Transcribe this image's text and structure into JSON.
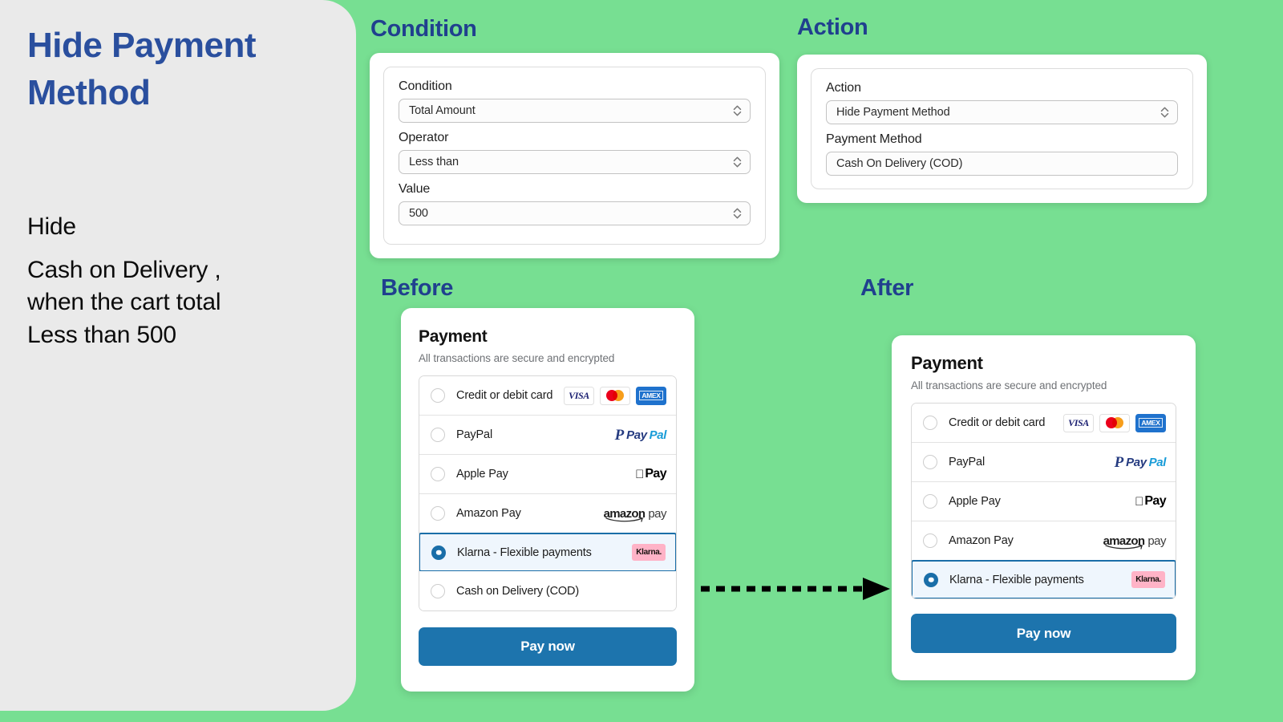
{
  "colors": {
    "background_green": "#77df92",
    "panel_gray": "#eaeaea",
    "heading_blue": "#20408e",
    "title_blue": "#2a4f9e",
    "button_blue": "#1d74ad",
    "selected_row_bg": "#eff6fd",
    "selected_row_border": "#1a6ea8",
    "klarna_pink": "#ffb3c7"
  },
  "left_panel": {
    "title": "Hide Payment Method",
    "description_lines": [
      "Hide",
      "Cash on Delivery ,",
      "when the cart total",
      "Less than 500"
    ]
  },
  "headings": {
    "condition": "Condition",
    "action": "Action",
    "before": "Before",
    "after": "After"
  },
  "condition_form": {
    "fields": [
      {
        "label": "Condition",
        "value": "Total Amount",
        "control": "select",
        "icon": "stepper-chevrons-icon"
      },
      {
        "label": "Operator",
        "value": "Less than",
        "control": "select",
        "icon": "stepper-chevrons-icon"
      },
      {
        "label": "Value",
        "value": "500",
        "control": "number",
        "icon": "stepper-chevrons-icon"
      }
    ]
  },
  "action_form": {
    "fields": [
      {
        "label": "Action",
        "value": "Hide Payment Method",
        "control": "select",
        "icon": "stepper-chevrons-icon"
      },
      {
        "label": "Payment Method",
        "value": "Cash On Delivery (COD)",
        "control": "text",
        "icon": ""
      }
    ]
  },
  "before_checkout": {
    "title": "Payment",
    "subtitle": "All transactions are secure and encrypted",
    "pay_button": "Pay now",
    "methods": [
      {
        "label": "Credit or debit card",
        "selected": false,
        "logo": "cards",
        "logo_labels": [
          "VISA",
          "mastercard-icon",
          "AMEX"
        ]
      },
      {
        "label": "PayPal",
        "selected": false,
        "logo": "paypal",
        "logo_labels": [
          "P",
          "Pay",
          "Pal"
        ]
      },
      {
        "label": "Apple Pay",
        "selected": false,
        "logo": "applepay",
        "logo_labels": [
          "apple-icon",
          "Pay"
        ]
      },
      {
        "label": "Amazon Pay",
        "selected": false,
        "logo": "amazonpay",
        "logo_labels": [
          "amazon",
          "pay"
        ]
      },
      {
        "label": "Klarna - Flexible payments",
        "selected": true,
        "logo": "klarna",
        "logo_labels": [
          "Klarna."
        ]
      },
      {
        "label": "Cash on Delivery (COD)",
        "selected": false,
        "logo": "none",
        "logo_labels": []
      }
    ]
  },
  "after_checkout": {
    "title": "Payment",
    "subtitle": "All transactions are secure and encrypted",
    "pay_button": "Pay now",
    "methods": [
      {
        "label": "Credit or debit card",
        "selected": false,
        "logo": "cards",
        "logo_labels": [
          "VISA",
          "mastercard-icon",
          "AMEX"
        ]
      },
      {
        "label": "PayPal",
        "selected": false,
        "logo": "paypal",
        "logo_labels": [
          "P",
          "Pay",
          "Pal"
        ]
      },
      {
        "label": "Apple Pay",
        "selected": false,
        "logo": "applepay",
        "logo_labels": [
          "apple-icon",
          "Pay"
        ]
      },
      {
        "label": "Amazon Pay",
        "selected": false,
        "logo": "amazonpay",
        "logo_labels": [
          "amazon",
          "pay"
        ]
      },
      {
        "label": "Klarna - Flexible payments",
        "selected": true,
        "logo": "klarna",
        "logo_labels": [
          "Klarna."
        ]
      }
    ]
  },
  "arrow": {
    "style": "dashed-right-arrow",
    "name": "before-to-after-arrow"
  }
}
